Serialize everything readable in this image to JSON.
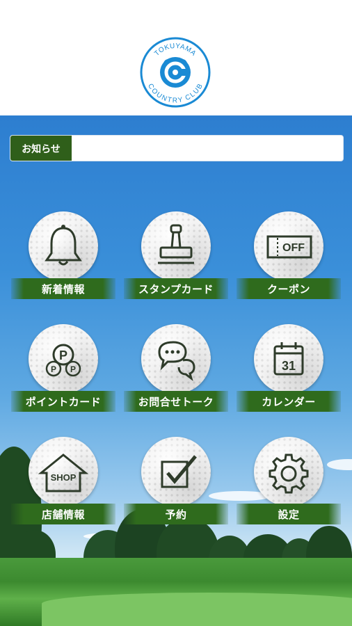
{
  "logo": {
    "top_text": "TOKUYAMA",
    "bottom_text": "COUNTRY CLUB",
    "letter": "C",
    "color": "#1a8ad4"
  },
  "news": {
    "label": "お知らせ",
    "content": ""
  },
  "menu": [
    {
      "label": "新着情報",
      "icon": "bell-icon"
    },
    {
      "label": "スタンプカード",
      "icon": "stamp-icon"
    },
    {
      "label": "クーポン",
      "icon": "coupon-icon",
      "icon_text": "OFF"
    },
    {
      "label": "ポイントカード",
      "icon": "points-icon",
      "icon_text": "P"
    },
    {
      "label": "お問合せトーク",
      "icon": "chat-icon"
    },
    {
      "label": "カレンダー",
      "icon": "calendar-icon",
      "icon_text": "31"
    },
    {
      "label": "店舗情報",
      "icon": "shop-icon",
      "icon_text": "SHOP"
    },
    {
      "label": "予約",
      "icon": "checkbox-icon"
    },
    {
      "label": "設定",
      "icon": "gear-icon"
    }
  ],
  "colors": {
    "accent_green": "#2f6b1d",
    "sky_blue": "#2d7ed0",
    "icon_stroke": "#2e3b2a"
  }
}
